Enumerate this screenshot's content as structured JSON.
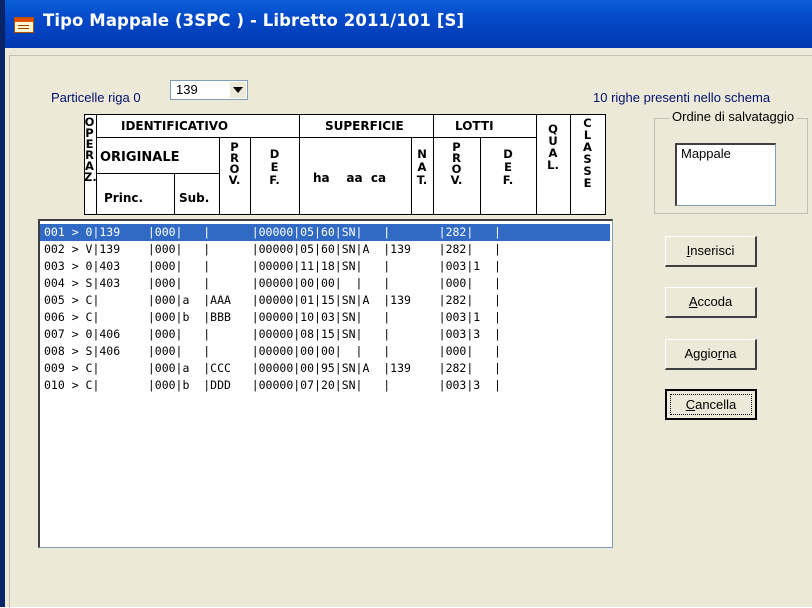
{
  "window": {
    "title": "Tipo Mappale (3SPC ) - Libretto 2011/101 [S]"
  },
  "filter": {
    "label": "Particelle riga 0",
    "combo_value": "139"
  },
  "info": {
    "rows_text": "10 righe presenti nello schema"
  },
  "header": {
    "operaz": [
      "O",
      "P",
      "E",
      "R",
      "A",
      "Z."
    ],
    "identificativo": "IDENTIFICATIVO",
    "originale": "ORIGINALE",
    "princ": "Princ.",
    "sub": "Sub.",
    "prov": [
      "P",
      "R",
      "O",
      "V."
    ],
    "def": [
      "D",
      "E",
      "F."
    ],
    "superficie": "SUPERFICIE",
    "ha_aa_ca": "ha    aa  ca",
    "nat": [
      "N",
      "A",
      "T."
    ],
    "lotti": "LOTTI",
    "lotti_prov": [
      "P",
      "R",
      "O",
      "V."
    ],
    "lotti_def": [
      "D",
      "E",
      "F."
    ],
    "qual": [
      "Q",
      "U",
      "A",
      "L."
    ],
    "classe": [
      "C",
      "L",
      "A",
      "S",
      "S",
      "E"
    ]
  },
  "rows": [
    "001 > 0|139    |000|   |      |00000|05|60|SN|   |       |282|   |",
    "002 > V|139    |000|   |      |00000|05|60|SN|A  |139    |282|   |",
    "003 > 0|403    |000|   |      |00000|11|18|SN|   |       |003|1  |",
    "004 > S|403    |000|   |      |00000|00|00|  |   |       |000|   |",
    "005 > C|       |000|a  |AAA   |00000|01|15|SN|A  |139    |282|   |",
    "006 > C|       |000|b  |BBB   |00000|10|03|SN|   |       |003|1  |",
    "007 > 0|406    |000|   |      |00000|08|15|SN|   |       |003|3  |",
    "008 > S|406    |000|   |      |00000|00|00|  |   |       |000|   |",
    "009 > C|       |000|a  |CCC   |00000|00|95|SN|A  |139    |282|   |",
    "010 > C|       |000|b  |DDD   |00000|07|20|SN|   |       |003|3  |"
  ],
  "selected_row": 0,
  "order_group": {
    "legend": "Ordine di salvataggio",
    "items": [
      "Mappale"
    ]
  },
  "buttons": {
    "inserisci": {
      "pre": "",
      "key": "I",
      "post": "nserisci"
    },
    "accoda": {
      "pre": "",
      "key": "A",
      "post": "ccoda"
    },
    "aggiorna": {
      "pre": "Aggio",
      "key": "r",
      "post": "na"
    },
    "cancella": {
      "pre": "",
      "key": "C",
      "post": "ancella"
    }
  }
}
